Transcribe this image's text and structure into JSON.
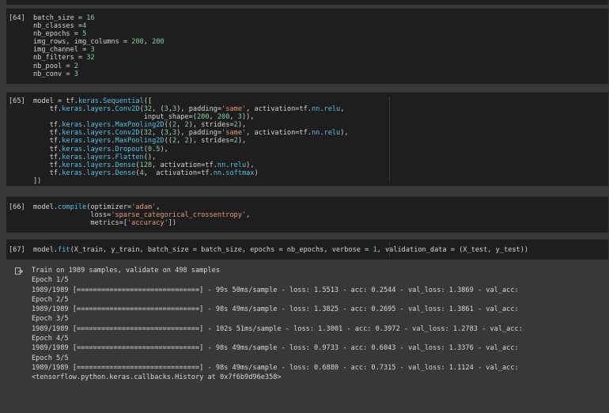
{
  "cells": [
    {
      "prompt": "[64]",
      "lines": [
        [
          {
            "t": "batch_size = ",
            "c": "plain"
          },
          {
            "t": "16",
            "c": "num"
          }
        ],
        [
          {
            "t": "nb_classes =",
            "c": "plain"
          },
          {
            "t": "4",
            "c": "num"
          }
        ],
        [
          {
            "t": "nb_epochs = ",
            "c": "plain"
          },
          {
            "t": "5",
            "c": "num"
          }
        ],
        [
          {
            "t": "img_rows, img_columns = ",
            "c": "plain"
          },
          {
            "t": "200",
            "c": "num"
          },
          {
            "t": ", ",
            "c": "plain"
          },
          {
            "t": "200",
            "c": "num"
          }
        ],
        [
          {
            "t": "img_channel = ",
            "c": "plain"
          },
          {
            "t": "3",
            "c": "num"
          }
        ],
        [
          {
            "t": "nb_filters = ",
            "c": "plain"
          },
          {
            "t": "32",
            "c": "num"
          }
        ],
        [
          {
            "t": "nb_pool = ",
            "c": "plain"
          },
          {
            "t": "2",
            "c": "num"
          }
        ],
        [
          {
            "t": "nb_conv = ",
            "c": "plain"
          },
          {
            "t": "3",
            "c": "num"
          }
        ]
      ]
    },
    {
      "prompt": "[65]",
      "lines": [
        [
          {
            "t": "model = ",
            "c": "plain"
          },
          {
            "t": "tf",
            "c": "plain"
          },
          {
            "t": ".",
            "c": "plain"
          },
          {
            "t": "keras",
            "c": "kw"
          },
          {
            "t": ".",
            "c": "plain"
          },
          {
            "t": "Sequential",
            "c": "kw"
          },
          {
            "t": "([",
            "c": "plain"
          }
        ],
        [
          {
            "t": "    tf.",
            "c": "plain"
          },
          {
            "t": "keras",
            "c": "kw"
          },
          {
            "t": ".",
            "c": "plain"
          },
          {
            "t": "layers",
            "c": "kw"
          },
          {
            "t": ".",
            "c": "plain"
          },
          {
            "t": "Conv2D",
            "c": "kw"
          },
          {
            "t": "(",
            "c": "plain"
          },
          {
            "t": "32",
            "c": "num"
          },
          {
            "t": ", (",
            "c": "plain"
          },
          {
            "t": "3",
            "c": "num"
          },
          {
            "t": ",",
            "c": "plain"
          },
          {
            "t": "3",
            "c": "num"
          },
          {
            "t": "), padding=",
            "c": "plain"
          },
          {
            "t": "'same'",
            "c": "str"
          },
          {
            "t": ", activation=tf.",
            "c": "plain"
          },
          {
            "t": "nn",
            "c": "kw"
          },
          {
            "t": ".",
            "c": "plain"
          },
          {
            "t": "relu",
            "c": "kw"
          },
          {
            "t": ",",
            "c": "plain"
          }
        ],
        [
          {
            "t": "                           input_shape=(",
            "c": "plain"
          },
          {
            "t": "200",
            "c": "num"
          },
          {
            "t": ", ",
            "c": "plain"
          },
          {
            "t": "200",
            "c": "num"
          },
          {
            "t": ", ",
            "c": "plain"
          },
          {
            "t": "3",
            "c": "num"
          },
          {
            "t": ")),",
            "c": "plain"
          }
        ],
        [
          {
            "t": "    tf.",
            "c": "plain"
          },
          {
            "t": "keras",
            "c": "kw"
          },
          {
            "t": ".",
            "c": "plain"
          },
          {
            "t": "layers",
            "c": "kw"
          },
          {
            "t": ".",
            "c": "plain"
          },
          {
            "t": "MaxPooling2D",
            "c": "kw"
          },
          {
            "t": "((",
            "c": "plain"
          },
          {
            "t": "2",
            "c": "num"
          },
          {
            "t": ", ",
            "c": "plain"
          },
          {
            "t": "2",
            "c": "num"
          },
          {
            "t": "), strides=",
            "c": "plain"
          },
          {
            "t": "2",
            "c": "num"
          },
          {
            "t": "),",
            "c": "plain"
          }
        ],
        [
          {
            "t": "    tf.",
            "c": "plain"
          },
          {
            "t": "keras",
            "c": "kw"
          },
          {
            "t": ".",
            "c": "plain"
          },
          {
            "t": "layers",
            "c": "kw"
          },
          {
            "t": ".",
            "c": "plain"
          },
          {
            "t": "Conv2D",
            "c": "kw"
          },
          {
            "t": "(",
            "c": "plain"
          },
          {
            "t": "32",
            "c": "num"
          },
          {
            "t": ", (",
            "c": "plain"
          },
          {
            "t": "3",
            "c": "num"
          },
          {
            "t": ",",
            "c": "plain"
          },
          {
            "t": "3",
            "c": "num"
          },
          {
            "t": "), padding=",
            "c": "plain"
          },
          {
            "t": "'same'",
            "c": "str"
          },
          {
            "t": ", activation=tf.",
            "c": "plain"
          },
          {
            "t": "nn",
            "c": "kw"
          },
          {
            "t": ".",
            "c": "plain"
          },
          {
            "t": "relu",
            "c": "kw"
          },
          {
            "t": "),",
            "c": "plain"
          }
        ],
        [
          {
            "t": "    tf.",
            "c": "plain"
          },
          {
            "t": "keras",
            "c": "kw"
          },
          {
            "t": ".",
            "c": "plain"
          },
          {
            "t": "layers",
            "c": "kw"
          },
          {
            "t": ".",
            "c": "plain"
          },
          {
            "t": "MaxPooling2D",
            "c": "kw"
          },
          {
            "t": "((",
            "c": "plain"
          },
          {
            "t": "2",
            "c": "num"
          },
          {
            "t": ", ",
            "c": "plain"
          },
          {
            "t": "2",
            "c": "num"
          },
          {
            "t": "), strides=",
            "c": "plain"
          },
          {
            "t": "2",
            "c": "num"
          },
          {
            "t": "),",
            "c": "plain"
          }
        ],
        [
          {
            "t": "    tf.",
            "c": "plain"
          },
          {
            "t": "keras",
            "c": "kw"
          },
          {
            "t": ".",
            "c": "plain"
          },
          {
            "t": "layers",
            "c": "kw"
          },
          {
            "t": ".",
            "c": "plain"
          },
          {
            "t": "Dropout",
            "c": "kw"
          },
          {
            "t": "(",
            "c": "plain"
          },
          {
            "t": "0.5",
            "c": "num"
          },
          {
            "t": "),",
            "c": "plain"
          }
        ],
        [
          {
            "t": "    tf.",
            "c": "plain"
          },
          {
            "t": "keras",
            "c": "kw"
          },
          {
            "t": ".",
            "c": "plain"
          },
          {
            "t": "layers",
            "c": "kw"
          },
          {
            "t": ".",
            "c": "plain"
          },
          {
            "t": "Flatten",
            "c": "kw"
          },
          {
            "t": "(),",
            "c": "plain"
          }
        ],
        [
          {
            "t": "    tf.",
            "c": "plain"
          },
          {
            "t": "keras",
            "c": "kw"
          },
          {
            "t": ".",
            "c": "plain"
          },
          {
            "t": "layers",
            "c": "kw"
          },
          {
            "t": ".",
            "c": "plain"
          },
          {
            "t": "Dense",
            "c": "kw"
          },
          {
            "t": "(",
            "c": "plain"
          },
          {
            "t": "128",
            "c": "num"
          },
          {
            "t": ", activation=tf.",
            "c": "plain"
          },
          {
            "t": "nn",
            "c": "kw"
          },
          {
            "t": ".",
            "c": "plain"
          },
          {
            "t": "relu",
            "c": "kw"
          },
          {
            "t": "),",
            "c": "plain"
          }
        ],
        [
          {
            "t": "    tf.",
            "c": "plain"
          },
          {
            "t": "keras",
            "c": "kw"
          },
          {
            "t": ".",
            "c": "plain"
          },
          {
            "t": "layers",
            "c": "kw"
          },
          {
            "t": ".",
            "c": "plain"
          },
          {
            "t": "Dense",
            "c": "kw"
          },
          {
            "t": "(",
            "c": "plain"
          },
          {
            "t": "4",
            "c": "num"
          },
          {
            "t": ",  activation=tf.",
            "c": "plain"
          },
          {
            "t": "nn",
            "c": "kw"
          },
          {
            "t": ".",
            "c": "plain"
          },
          {
            "t": "softmax",
            "c": "kw"
          },
          {
            "t": ")",
            "c": "plain"
          }
        ],
        [
          {
            "t": "])",
            "c": "plain"
          }
        ]
      ]
    },
    {
      "prompt": "[66]",
      "lines": [
        [
          {
            "t": "model.",
            "c": "plain"
          },
          {
            "t": "compile",
            "c": "kw"
          },
          {
            "t": "(optimizer=",
            "c": "plain"
          },
          {
            "t": "'adam'",
            "c": "str"
          },
          {
            "t": ",",
            "c": "plain"
          }
        ],
        [
          {
            "t": "              loss=",
            "c": "plain"
          },
          {
            "t": "'sparse_categorical_crossentropy'",
            "c": "str"
          },
          {
            "t": ",",
            "c": "plain"
          }
        ],
        [
          {
            "t": "              metrics=[",
            "c": "plain"
          },
          {
            "t": "'accuracy'",
            "c": "str"
          },
          {
            "t": "])",
            "c": "plain"
          }
        ]
      ]
    },
    {
      "prompt": "[67]",
      "lines": [
        [
          {
            "t": "model.",
            "c": "plain"
          },
          {
            "t": "fit",
            "c": "kw"
          },
          {
            "t": "(X_train, y_train, batch_size = batch_size, epochs = nb_epochs, verbose = ",
            "c": "plain"
          },
          {
            "t": "1",
            "c": "num"
          },
          {
            "t": ", validation_data = (X_test, y_test))",
            "c": "plain"
          }
        ]
      ]
    }
  ],
  "output": {
    "lines": [
      "Train on 1989 samples, validate on 498 samples",
      "Epoch 1/5",
      "1989/1989 [==============================] - 99s 50ms/sample - loss: 1.5513 - acc: 0.2544 - val_loss: 1.3869 - val_acc:",
      "Epoch 2/5",
      "1989/1989 [==============================] - 98s 49ms/sample - loss: 1.3825 - acc: 0.2695 - val_loss: 1.3861 - val_acc:",
      "Epoch 3/5",
      "1989/1989 [==============================] - 102s 51ms/sample - loss: 1.3001 - acc: 0.3972 - val_loss: 1.2783 - val_acc:",
      "Epoch 4/5",
      "1989/1989 [==============================] - 98s 49ms/sample - loss: 0.9733 - acc: 0.6043 - val_loss: 1.3376 - val_acc:",
      "Epoch 5/5",
      "1989/1989 [==============================] - 98s 49ms/sample - loss: 0.6880 - acc: 0.7315 - val_loss: 1.1124 - val_acc:",
      "<tensorflow.python.keras.callbacks.History at 0x7f6b9d96e358>"
    ],
    "icon": "output-arrow-icon"
  },
  "colors": {
    "keyword": "#4fc1e9",
    "number": "#7fd3a0",
    "string": "#e39a78",
    "cell_bg": "#1e1e1e",
    "page_bg": "#383838"
  }
}
